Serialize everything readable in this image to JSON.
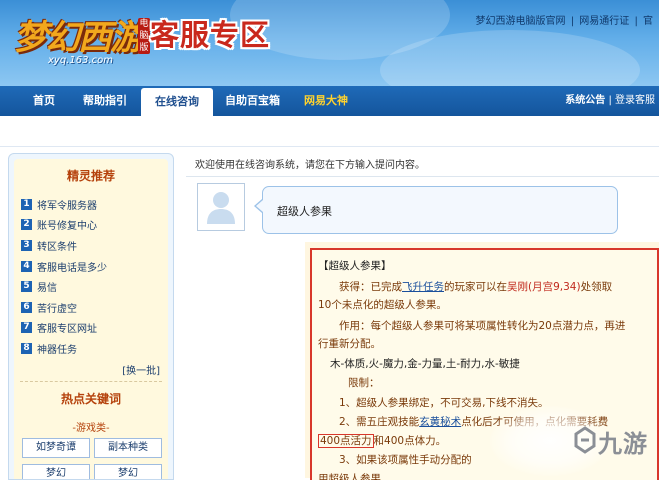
{
  "header": {
    "logo_text": "梦幻西游",
    "logo_badge": "电脑版",
    "logo_url": "xyq.163.com",
    "zone_title": "客服专区",
    "top_links": [
      "梦幻西游电脑版官网",
      "网易通行证",
      "官"
    ]
  },
  "nav": {
    "items": [
      {
        "label": "首页"
      },
      {
        "label": "帮助指引"
      },
      {
        "label": "在线咨询"
      },
      {
        "label": "自助百宝箱"
      },
      {
        "label": "网易大神"
      }
    ],
    "right_links": [
      "系统公告",
      "登录客服"
    ]
  },
  "sidebar": {
    "title": "精灵推荐",
    "items": [
      {
        "num": "1",
        "label": "将军令服务器"
      },
      {
        "num": "2",
        "label": "账号修复中心"
      },
      {
        "num": "3",
        "label": "转区条件"
      },
      {
        "num": "4",
        "label": "客服电话是多少"
      },
      {
        "num": "5",
        "label": "易信"
      },
      {
        "num": "6",
        "label": "苦行虚空"
      },
      {
        "num": "7",
        "label": "客服专区网址"
      },
      {
        "num": "8",
        "label": "神器任务"
      }
    ],
    "more": "[换一批]",
    "keywords_title": "热点关键词",
    "keywords_sub": "-游戏类-",
    "keywords": [
      "如梦奇谭",
      "副本种类",
      "梦幻",
      "梦幻"
    ]
  },
  "main": {
    "welcome": "欢迎使用在线咨询系统，请您在下方输入提问内容。",
    "question": "超级人参果",
    "answer": {
      "line1": "【超级人参果】",
      "line2_a": "获得：已完成",
      "line2_link1": "飞升任务",
      "line2_b": "的玩家可以在",
      "line2_red": "吴刚(月宫9,34)",
      "line2_c": "处领取",
      "line3": "10个未点化的超级人参果。",
      "line4": "作用：每个超级人参果可将某项属性转化为20点潜力点，再进",
      "line5": "行重新分配。",
      "line6": "木-体质,火-魔力,金-力量,土-耐力,水-敏捷",
      "line7": "限制：",
      "line8": "1、超级人参果绑定，不可交易,下线不消失。",
      "line9_a": "2、需五庄观技能",
      "line9_link": "玄黄秘术",
      "line9_b": "点化后才可使用，点化需要耗费",
      "line10_box": "400点活力",
      "line10_b": "和400点体力。",
      "line11": "3、如果该项属性手动分配的",
      "line12": "用超级人参果。"
    }
  },
  "watermark": {
    "text": "九游"
  }
}
